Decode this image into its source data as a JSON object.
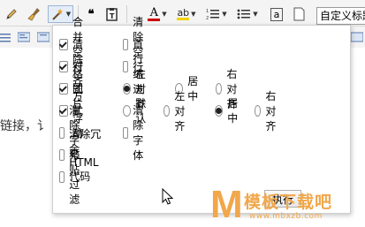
{
  "toolbar": {
    "icons": [
      "pencil-icon",
      "broom-icon",
      "magic-wand-icon",
      "quote-icon",
      "paste-text-icon",
      "font-color-icon",
      "highlight-icon",
      "ordered-list-icon",
      "unordered-list-icon",
      "special-char-icon",
      "page-icon"
    ],
    "quote_glyph": "66",
    "font_color_glyph": "A",
    "highlight_glyph": "ab",
    "special_char_glyph": "a",
    "font_select_value": "自定义标题",
    "font_color_bar": "#cc0000"
  },
  "body_text": "链接，讠",
  "panel": {
    "rows": [
      {
        "label": "合并空行",
        "checked": true
      },
      {
        "label": "清除格式",
        "checked": true
      },
      {
        "label": "对齐方式",
        "checked": true
      },
      {
        "label": "图片浮动",
        "checked": true
      },
      {
        "label": "清除字号",
        "checked": false
      },
      {
        "label": "清除冗余HTML代码",
        "checked": false
      },
      {
        "label": "粘贴过滤",
        "checked": false
      }
    ],
    "clear_blank": {
      "label": "清除空行",
      "checked": false
    },
    "indent": {
      "label": "首行缩进",
      "checked": false
    },
    "clear_font": {
      "label": "清除字体",
      "checked": false
    },
    "align_options": [
      {
        "label": "左对齐",
        "selected": true
      },
      {
        "label": "居中",
        "selected": false
      },
      {
        "label": "右对齐",
        "selected": false
      }
    ],
    "float_options": [
      {
        "label": "默认",
        "selected": false
      },
      {
        "label": "左对齐",
        "selected": false
      },
      {
        "label": "居中",
        "selected": true
      },
      {
        "label": "右对齐",
        "selected": false
      }
    ],
    "execute_label": "执行"
  },
  "watermark": {
    "letter": "M",
    "name": "模板下载吧",
    "url": "www.mbxzb.com",
    "color": "#f1a74a"
  }
}
